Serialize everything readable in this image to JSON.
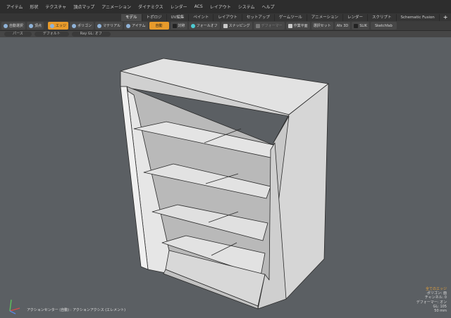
{
  "menu": {
    "items": [
      "アイテム",
      "形状",
      "テクスチャ",
      "頂点マップ",
      "アニメーション",
      "ダイナミクス",
      "レンダー",
      "ACS",
      "レイアウト",
      "システム",
      "ヘルプ"
    ]
  },
  "tabs": {
    "items": [
      {
        "label": "モデル",
        "active": true
      },
      {
        "label": "トポロジ",
        "active": false
      },
      {
        "label": "UV編集",
        "active": false
      },
      {
        "label": "ペイント",
        "active": false
      },
      {
        "label": "レイアウト",
        "active": false
      },
      {
        "label": "セットアップ",
        "active": false
      },
      {
        "label": "ゲームツール",
        "active": false
      },
      {
        "label": "アニメーション",
        "active": false
      },
      {
        "label": "レンダー",
        "active": false
      },
      {
        "label": "スクリプト",
        "active": false
      },
      {
        "label": "Schematic Fusion",
        "active": false
      }
    ],
    "add_label": "+"
  },
  "toolbar": {
    "auto_select": "自動選択",
    "vertex": "頂点",
    "edge": "エッジ",
    "polygon": "ポリゴン",
    "material": "マテリアル",
    "item": "アイテム",
    "auto": "自動",
    "symmetry": "対称",
    "falloff": "フォールオフ",
    "snapping": "スナッピング",
    "deform": "デフォーマー",
    "workplane": "作業平面",
    "selection_set": "選択セット",
    "afx": "Afx 3D",
    "slik": "SLIK",
    "sketchfab": "Sketchfab"
  },
  "subbar": {
    "items": [
      "パース",
      "デフォルト",
      "Ray GL: オフ"
    ]
  },
  "status": {
    "action_center": "アクションセンター (自動) : アクションアクシス (エレメント)"
  },
  "info": {
    "title": "全てのエッジ",
    "lines": [
      "ポリゴン: 面",
      "チャンネル: 0",
      "デフォーマー: オン",
      "GL: 105",
      "50 mm"
    ]
  },
  "colors": {
    "viewport_bg": "#5b5f63",
    "active_tool": "#e79a2b",
    "mesh_face": "#dcdcdc",
    "mesh_edge": "#2a2a2a"
  }
}
